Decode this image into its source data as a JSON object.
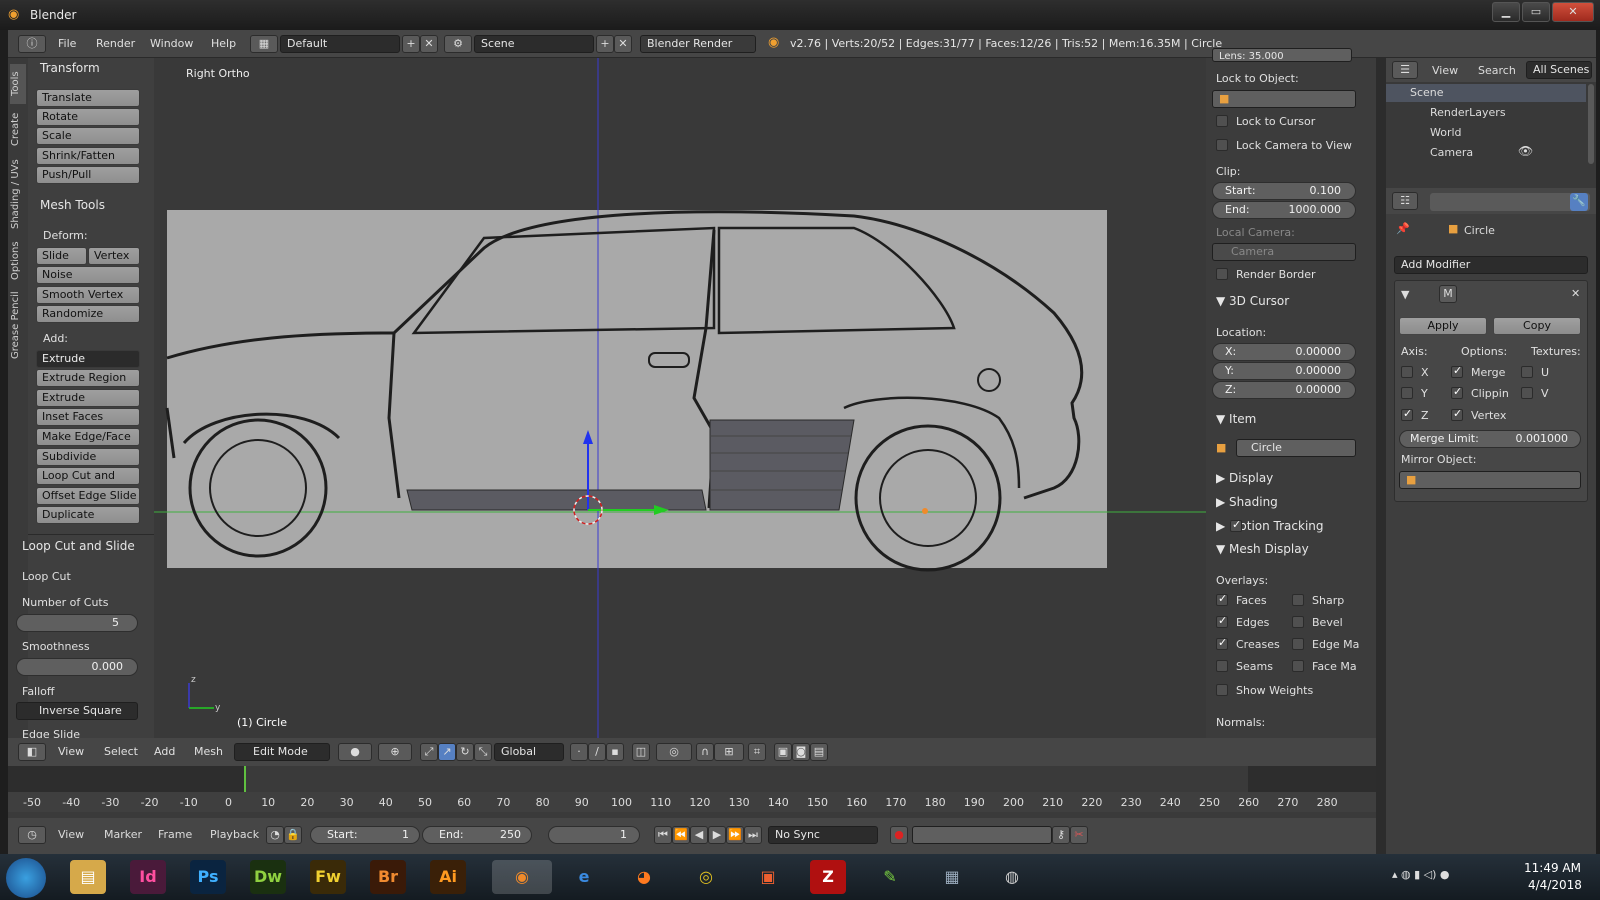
{
  "window": {
    "title": "Blender",
    "min": "▁",
    "max": "▭",
    "close": "✕"
  },
  "menu": {
    "file": "File",
    "render": "Render",
    "window": "Window",
    "help": "Help"
  },
  "layout": "Default",
  "scene": "Scene",
  "engine": "Blender Render",
  "stats": "v2.76 | Verts:20/52 | Edges:31/77 | Faces:12/26 | Tris:52 | Mem:16.35M | Circle",
  "tabs": [
    "Tools",
    "Create",
    "Shading / UVs",
    "Options",
    "Grease Pencil"
  ],
  "tools": {
    "transform_hdr": "Transform",
    "transform": [
      "Translate",
      "Rotate",
      "Scale",
      "Shrink/Fatten",
      "Push/Pull"
    ],
    "meshtools_hdr": "Mesh Tools",
    "deform_lbl": "Deform:",
    "slide_edge": "Slide Ed",
    "vertex": "Vertex",
    "deform": [
      "Noise",
      "Smooth Vertex",
      "Randomize"
    ],
    "add_lbl": "Add:",
    "extrude": "Extrude",
    "add": [
      "Extrude Region",
      "Extrude Individual",
      "Inset Faces",
      "Make Edge/Face",
      "Subdivide",
      "Loop Cut and Slide",
      "Offset Edge Slide",
      "Duplicate"
    ]
  },
  "operator": {
    "hdr": "Loop Cut and Slide",
    "loopcut": "Loop Cut",
    "cuts_lbl": "Number of Cuts",
    "cuts": "5",
    "smooth_lbl": "Smoothness",
    "smooth": "0.000",
    "falloff_lbl": "Falloff",
    "falloff": "Inverse Square",
    "edgeslide": "Edge Slide"
  },
  "viewport": {
    "view_name": "Right Ortho",
    "object_label": "(1) Circle"
  },
  "npanel": {
    "lens": "Lens:        35.000",
    "lock_obj": "Lock to Object:",
    "lock_cursor": "Lock to Cursor",
    "lock_camera": "Lock Camera to View",
    "clip": "Clip:",
    "clip_start_lbl": "Start:",
    "clip_start": "0.100",
    "clip_end_lbl": "End:",
    "clip_end": "1000.000",
    "local_camera": "Local Camera:",
    "camera": "Camera",
    "render_border": "Render Border",
    "cursor_hdr": "3D Cursor",
    "location": "Location:",
    "x_lbl": "X:",
    "x": "0.00000",
    "y_lbl": "Y:",
    "y": "0.00000",
    "z_lbl": "Z:",
    "z": "0.00000",
    "item_hdr": "Item",
    "item_name": "Circle",
    "display": "Display",
    "shading": "Shading",
    "motion": "Motion Tracking",
    "meshdisplay": "Mesh Display",
    "overlays": "Overlays:",
    "faces": "Faces",
    "sharp": "Sharp",
    "edges": "Edges",
    "bevel": "Bevel",
    "creases": "Creases",
    "edgema": "Edge Ma",
    "seams": "Seams",
    "facema": "Face Ma",
    "weights": "Show Weights",
    "normals": "Normals:"
  },
  "outliner": {
    "view": "View",
    "search": "Search",
    "allscenes": "All Scenes",
    "items": [
      "Scene",
      "RenderLayers",
      "World",
      "Camera",
      "Circle"
    ]
  },
  "props": {
    "object": "Circle",
    "add_modifier": "Add Modifier",
    "mod_name": "M",
    "apply": "Apply",
    "copy": "Copy",
    "axis": "Axis:",
    "options": "Options:",
    "textures": "Textures:",
    "x": "X",
    "y": "Y",
    "z": "Z",
    "merge": "Merge",
    "clippin": "Clippin",
    "vertex": "Vertex",
    "u": "U",
    "v": "V",
    "merge_limit": "Merge Limit:",
    "merge_val": "0.001000",
    "mirror_obj": "Mirror Object:"
  },
  "vpheader": {
    "view": "View",
    "select": "Select",
    "add": "Add",
    "mesh": "Mesh",
    "mode": "Edit Mode",
    "orient": "Global"
  },
  "timeline": {
    "ticks": [
      "-50",
      "-40",
      "-30",
      "-20",
      "-10",
      "0",
      "10",
      "20",
      "30",
      "40",
      "50",
      "60",
      "70",
      "80",
      "90",
      "100",
      "110",
      "120",
      "130",
      "140",
      "150",
      "160",
      "170",
      "180",
      "190",
      "200",
      "210",
      "220",
      "230",
      "240",
      "250",
      "260",
      "270",
      "280"
    ],
    "view": "View",
    "marker": "Marker",
    "frame": "Frame",
    "playback": "Playback",
    "start_lbl": "Start:",
    "start": "1",
    "end_lbl": "End:",
    "end": "250",
    "current": "1",
    "sync": "No Sync"
  },
  "taskbar": {
    "time": "11:49 AM",
    "date": "4/4/2018",
    "apps": [
      "Id",
      "Ps",
      "Dw",
      "Fw",
      "Br",
      "Ai"
    ]
  }
}
